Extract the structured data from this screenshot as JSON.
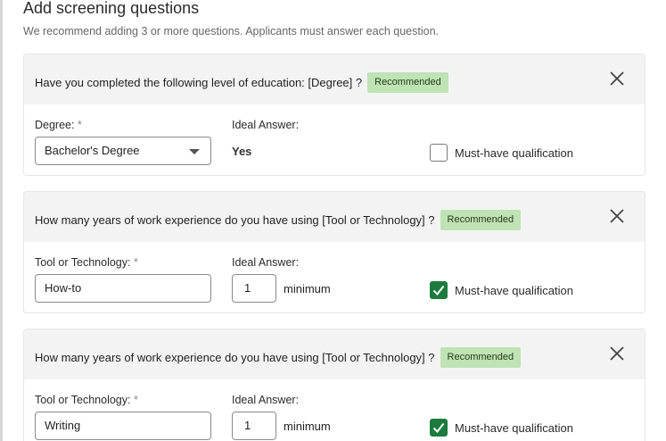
{
  "header": {
    "title": "Add screening questions",
    "subtitle": "We recommend adding 3 or more questions. Applicants must answer each question."
  },
  "questions": [
    {
      "text": "Have you completed the following level of education: [Degree] ?",
      "badge": "Recommended",
      "param_label": "Degree:",
      "required_mark": "*",
      "param_value": "Bachelor's Degree",
      "ideal_label": "Ideal Answer:",
      "ideal_value": "Yes",
      "must_have_label": "Must-have qualification",
      "must_have_checked": false
    },
    {
      "text": "How many years of work experience do you have using [Tool or Technology] ?",
      "badge": "Recommended",
      "param_label": "Tool or Technology:",
      "required_mark": "*",
      "param_value": "How-to",
      "ideal_label": "Ideal Answer:",
      "ideal_value": "1",
      "ideal_suffix": "minimum",
      "must_have_label": "Must-have qualification",
      "must_have_checked": true
    },
    {
      "text": "How many years of work experience do you have using [Tool or Technology] ?",
      "badge": "Recommended",
      "param_label": "Tool or Technology:",
      "required_mark": "*",
      "param_value": "Writing",
      "ideal_label": "Ideal Answer:",
      "ideal_value": "1",
      "ideal_suffix": "minimum",
      "must_have_label": "Must-have qualification",
      "must_have_checked": true
    }
  ],
  "colors": {
    "badge_bg": "#bfe3b4",
    "checkbox_checked": "#1c7b3d",
    "header_bg": "#f3f3f3"
  }
}
